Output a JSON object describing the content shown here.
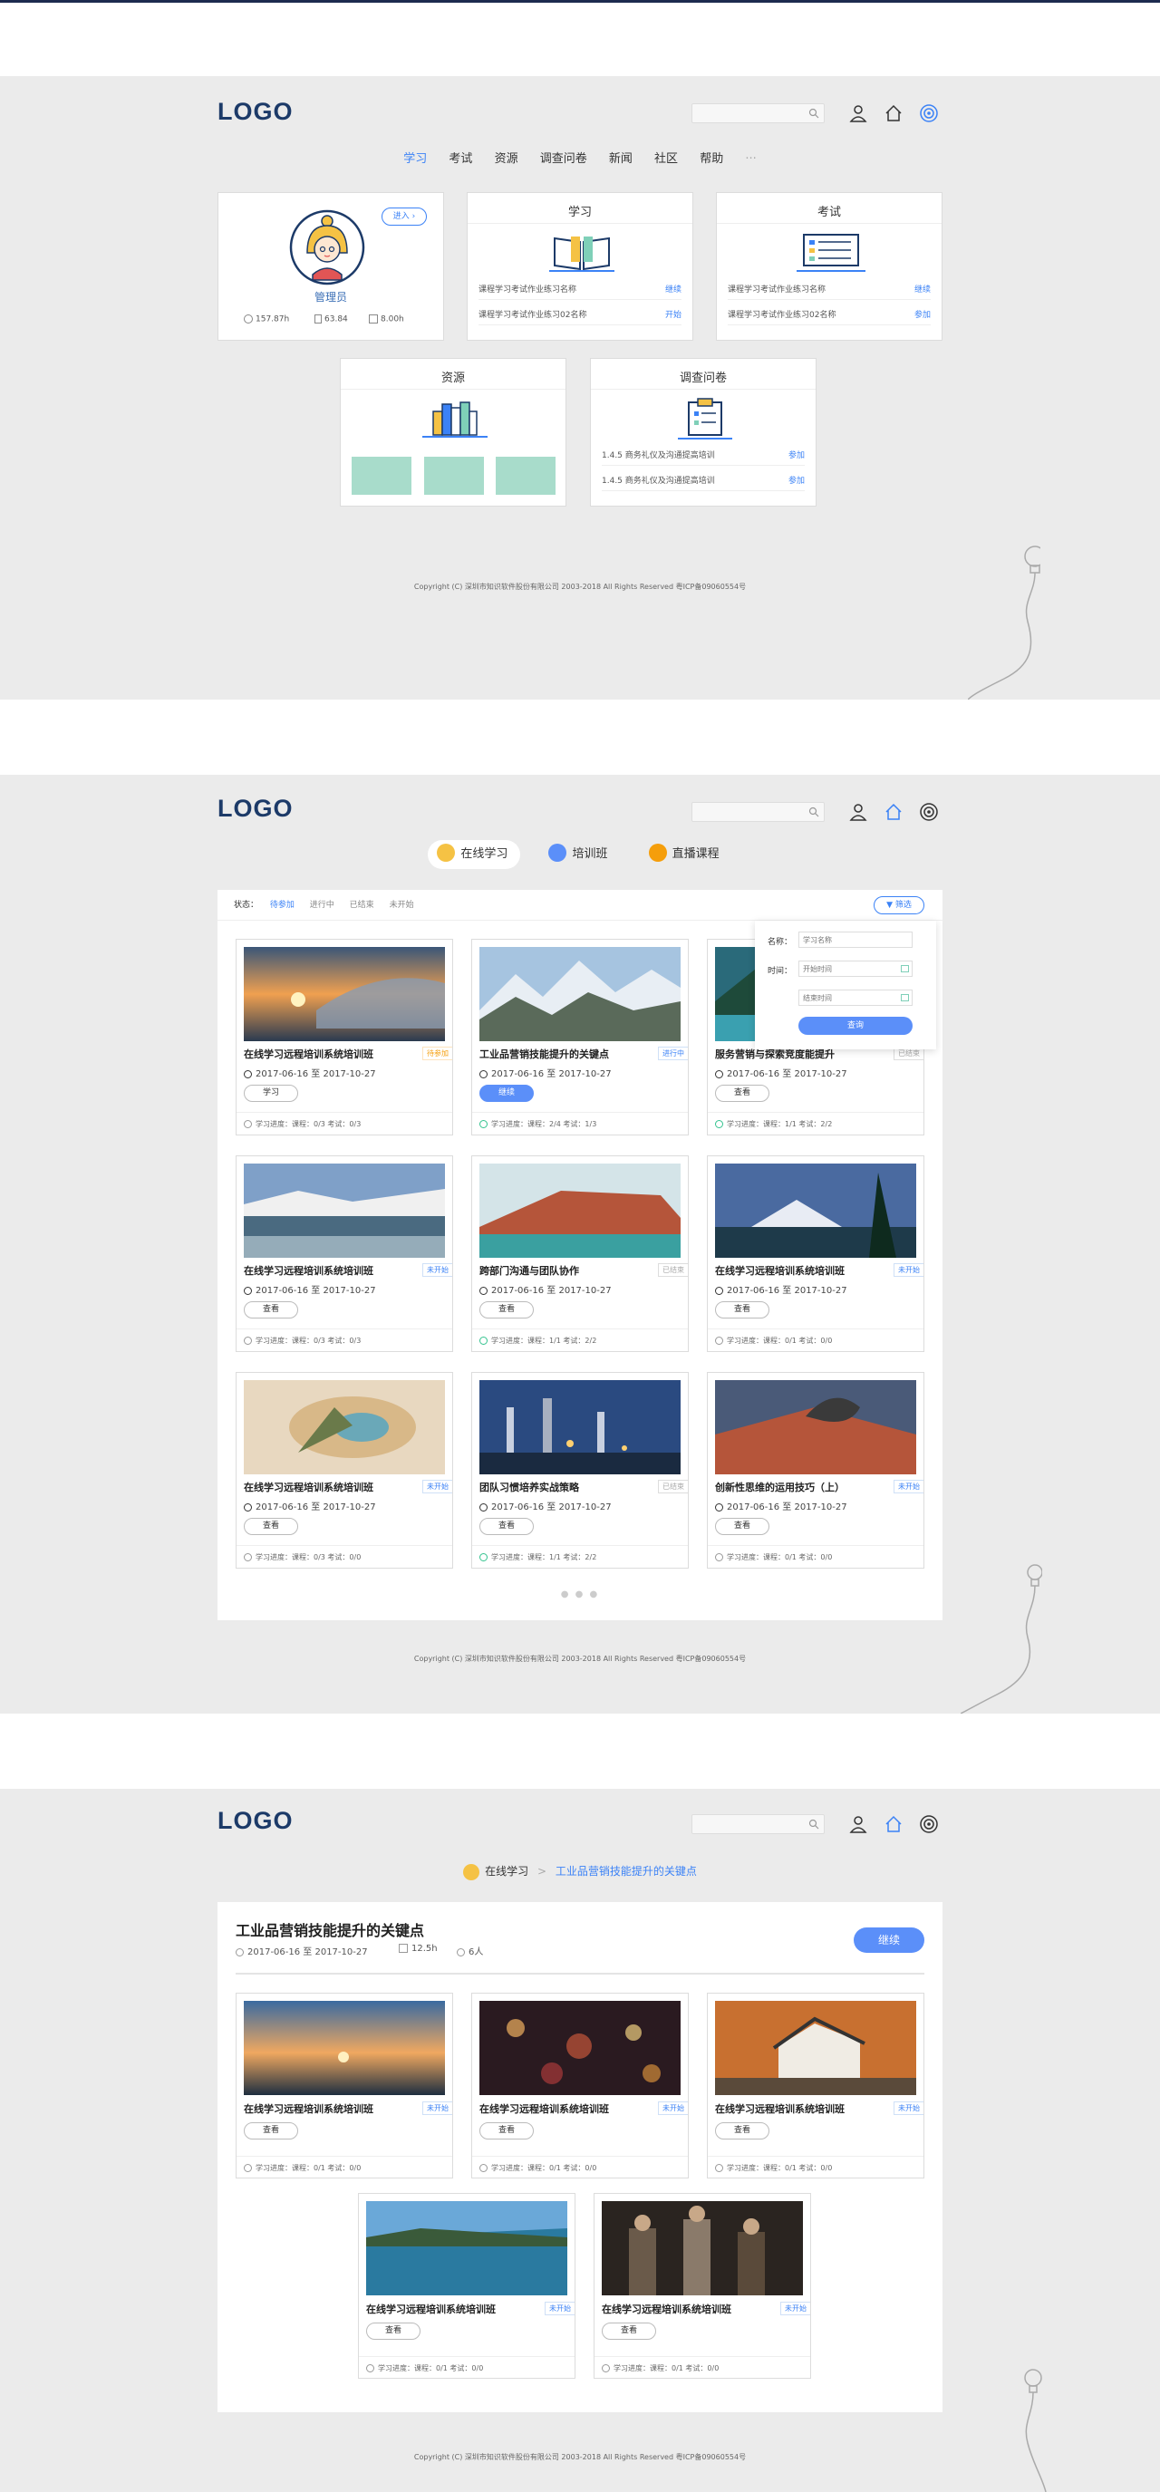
{
  "screen1": {
    "logo": "LOGO",
    "nav": [
      "学习",
      "考试",
      "资源",
      "调查问卷",
      "新闻",
      "社区",
      "帮助",
      "···"
    ],
    "profile": {
      "enter_label": "进入",
      "name": "管理员",
      "stats": [
        "157.87h",
        "63.84",
        "8.00h"
      ]
    },
    "study_card": {
      "title": "学习",
      "items": [
        {
          "text": "课程学习考试作业练习名称",
          "action": "继续"
        },
        {
          "text": "课程学习考试作业练习02名称",
          "action": "开始"
        }
      ]
    },
    "exam_card": {
      "title": "考试",
      "items": [
        {
          "text": "课程学习考试作业练习名称",
          "action": "继续"
        },
        {
          "text": "课程学习考试作业练习02名称",
          "action": "参加"
        }
      ]
    },
    "resource_card": {
      "title": "资源"
    },
    "survey_card": {
      "title": "调查问卷",
      "items": [
        {
          "text": "1.4.5 商务礼仪及沟通提高培训",
          "action": "参加"
        },
        {
          "text": "1.4.5 商务礼仪及沟通提高培训",
          "action": "参加"
        }
      ]
    },
    "footer": "Copyright (C) 深圳市知识软件股份有限公司 2003-2018 All Rights Reserved 粤ICP备09060554号"
  },
  "screen2": {
    "logo": "LOGO",
    "tabs": [
      "在线学习",
      "培训班",
      "直播课程"
    ],
    "status_label": "状态：",
    "filters": [
      "待参加",
      "进行中",
      "已结束",
      "未开始"
    ],
    "filter_button": "筛选",
    "filter_panel": {
      "name_label": "名称：",
      "name_placeholder": "学习名称",
      "time_label": "时间：",
      "start_placeholder": "开始时间",
      "end_placeholder": "结束时间",
      "query_button": "查询"
    },
    "courses": [
      {
        "title": "在线学习远程培训系统培训班",
        "badge": "待参加",
        "date": "2017-06-16 至 2017-10-27",
        "button": "学习",
        "progress": "学习进度：课程：0/3   考试：0/3"
      },
      {
        "title": "工业品营销技能提升的关键点",
        "badge": "进行中",
        "date": "2017-06-16 至 2017-10-27",
        "button": "继续",
        "progress": "学习进度：课程：2/4   考试：1/3"
      },
      {
        "title": "服务营销与探索竞度能提升",
        "badge": "已结束",
        "date": "2017-06-16 至 2017-10-27",
        "button": "查看",
        "progress": "学习进度：课程：1/1   考试：2/2"
      },
      {
        "title": "在线学习远程培训系统培训班",
        "badge": "未开始",
        "date": "2017-06-16 至 2017-10-27",
        "button": "查看",
        "progress": "学习进度：课程：0/3   考试：0/3"
      },
      {
        "title": "跨部门沟通与团队协作",
        "badge": "已结束",
        "date": "2017-06-16 至 2017-10-27",
        "button": "查看",
        "progress": "学习进度：课程：1/1   考试：2/2"
      },
      {
        "title": "在线学习远程培训系统培训班",
        "badge": "未开始",
        "date": "2017-06-16 至 2017-10-27",
        "button": "查看",
        "progress": "学习进度：课程：0/1   考试：0/0"
      },
      {
        "title": "在线学习远程培训系统培训班",
        "badge": "未开始",
        "date": "2017-06-16 至 2017-10-27",
        "button": "查看",
        "progress": "学习进度：课程：0/3   考试：0/0"
      },
      {
        "title": "团队习惯培养实战策略",
        "badge": "已结束",
        "date": "2017-06-16 至 2017-10-27",
        "button": "查看",
        "progress": "学习进度：课程：1/1   考试：2/2"
      },
      {
        "title": "创新性思维的运用技巧（上）",
        "badge": "未开始",
        "date": "2017-06-16 至 2017-10-27",
        "button": "查看",
        "progress": "学习进度：课程：0/1   考试：0/0"
      }
    ],
    "footer": "Copyright (C) 深圳市知识软件股份有限公司 2003-2018 All Rights Reserved 粤ICP备09060554号"
  },
  "screen3": {
    "logo": "LOGO",
    "breadcrumb_root": "在线学习",
    "breadcrumb_sep": ">",
    "breadcrumb_current": "工业品营销技能提升的关键点",
    "detail": {
      "title": "工业品营销技能提升的关键点",
      "date": "2017-06-16 至 2017-10-27",
      "hours": "12.5h",
      "people": "6人",
      "continue_button": "继续"
    },
    "courses": [
      {
        "title": "在线学习远程培训系统培训班",
        "badge": "未开始",
        "button": "查看",
        "progress": "学习进度：课程：0/1   考试：0/0"
      },
      {
        "title": "在线学习远程培训系统培训班",
        "badge": "未开始",
        "button": "查看",
        "progress": "学习进度：课程：0/1   考试：0/0"
      },
      {
        "title": "在线学习远程培训系统培训班",
        "badge": "未开始",
        "button": "查看",
        "progress": "学习进度：课程：0/1   考试：0/0"
      },
      {
        "title": "在线学习远程培训系统培训班",
        "badge": "未开始",
        "button": "查看",
        "progress": "学习进度：课程：0/1   考试：0/0"
      },
      {
        "title": "在线学习远程培训系统培训班",
        "badge": "未开始",
        "button": "查看",
        "progress": "学习进度：课程：0/1   考试：0/0"
      }
    ],
    "footer": "Copyright (C) 深圳市知识软件股份有限公司 2003-2018 All Rights Reserved 粤ICP备09060554号"
  },
  "colors": {
    "accent": "#3b82f6",
    "button_blue": "#5b8ff9",
    "logo": "#1c3a68",
    "background": "#ebebeb",
    "teal": "#a8dccb",
    "orange": "#f59e0b"
  },
  "icons": [
    "search-icon",
    "user-icon",
    "home-icon",
    "target-icon",
    "clock-icon",
    "book-icon",
    "people-icon",
    "filter-icon",
    "calendar-icon",
    "bulb-icon"
  ]
}
